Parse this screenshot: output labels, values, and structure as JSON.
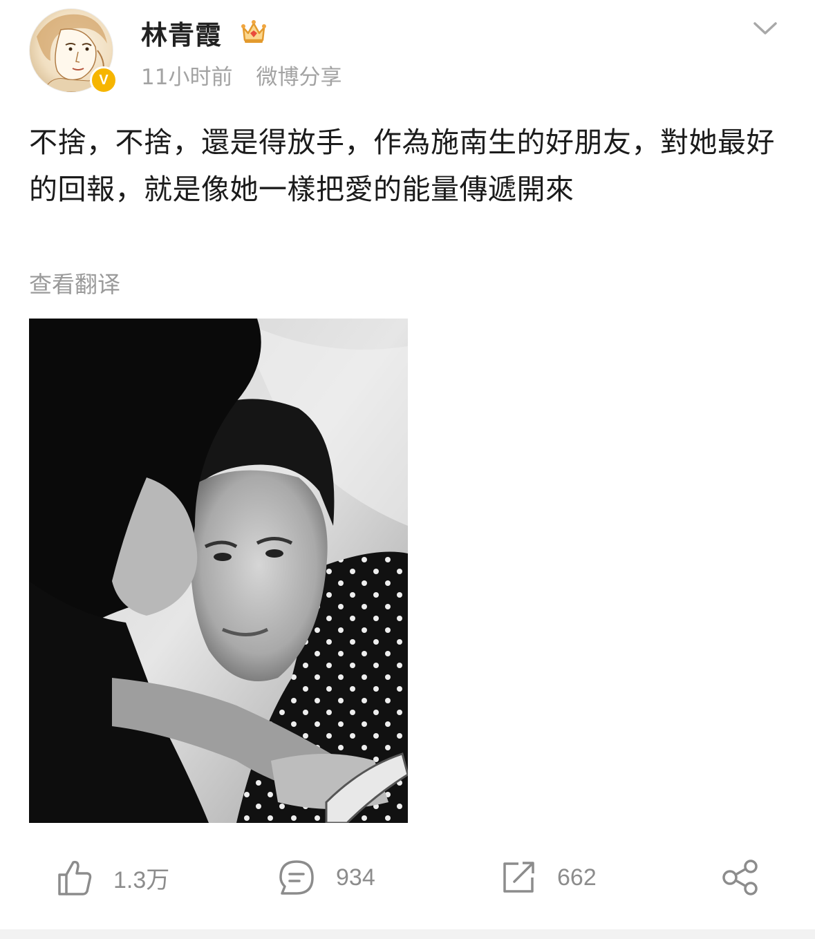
{
  "post": {
    "author": {
      "name": "林青霞",
      "badge_icon": "crown-icon",
      "verified_mark": "V",
      "avatar_icon": "avatar-illustration"
    },
    "meta": {
      "time": "11小时前",
      "source": "微博分享"
    },
    "text": "不捨，不捨，還是得放手，作為施南生的好朋友，對她最好的回報，就是像她一樣把愛的能量傳遞開來",
    "translate_link": "查看翻译",
    "image": {
      "icon": "black-and-white-photo",
      "description_visible": false
    },
    "actions": {
      "like": {
        "icon": "thumbs-up-icon",
        "count": "1.3万"
      },
      "comment": {
        "icon": "comment-icon",
        "count": "934"
      },
      "repost": {
        "icon": "repost-icon",
        "count": "662"
      },
      "share": {
        "icon": "share-icon"
      }
    },
    "colors": {
      "verified": "#f6b500",
      "meta_text": "#a3a3a3",
      "action_gray": "#8c8c8c"
    }
  }
}
